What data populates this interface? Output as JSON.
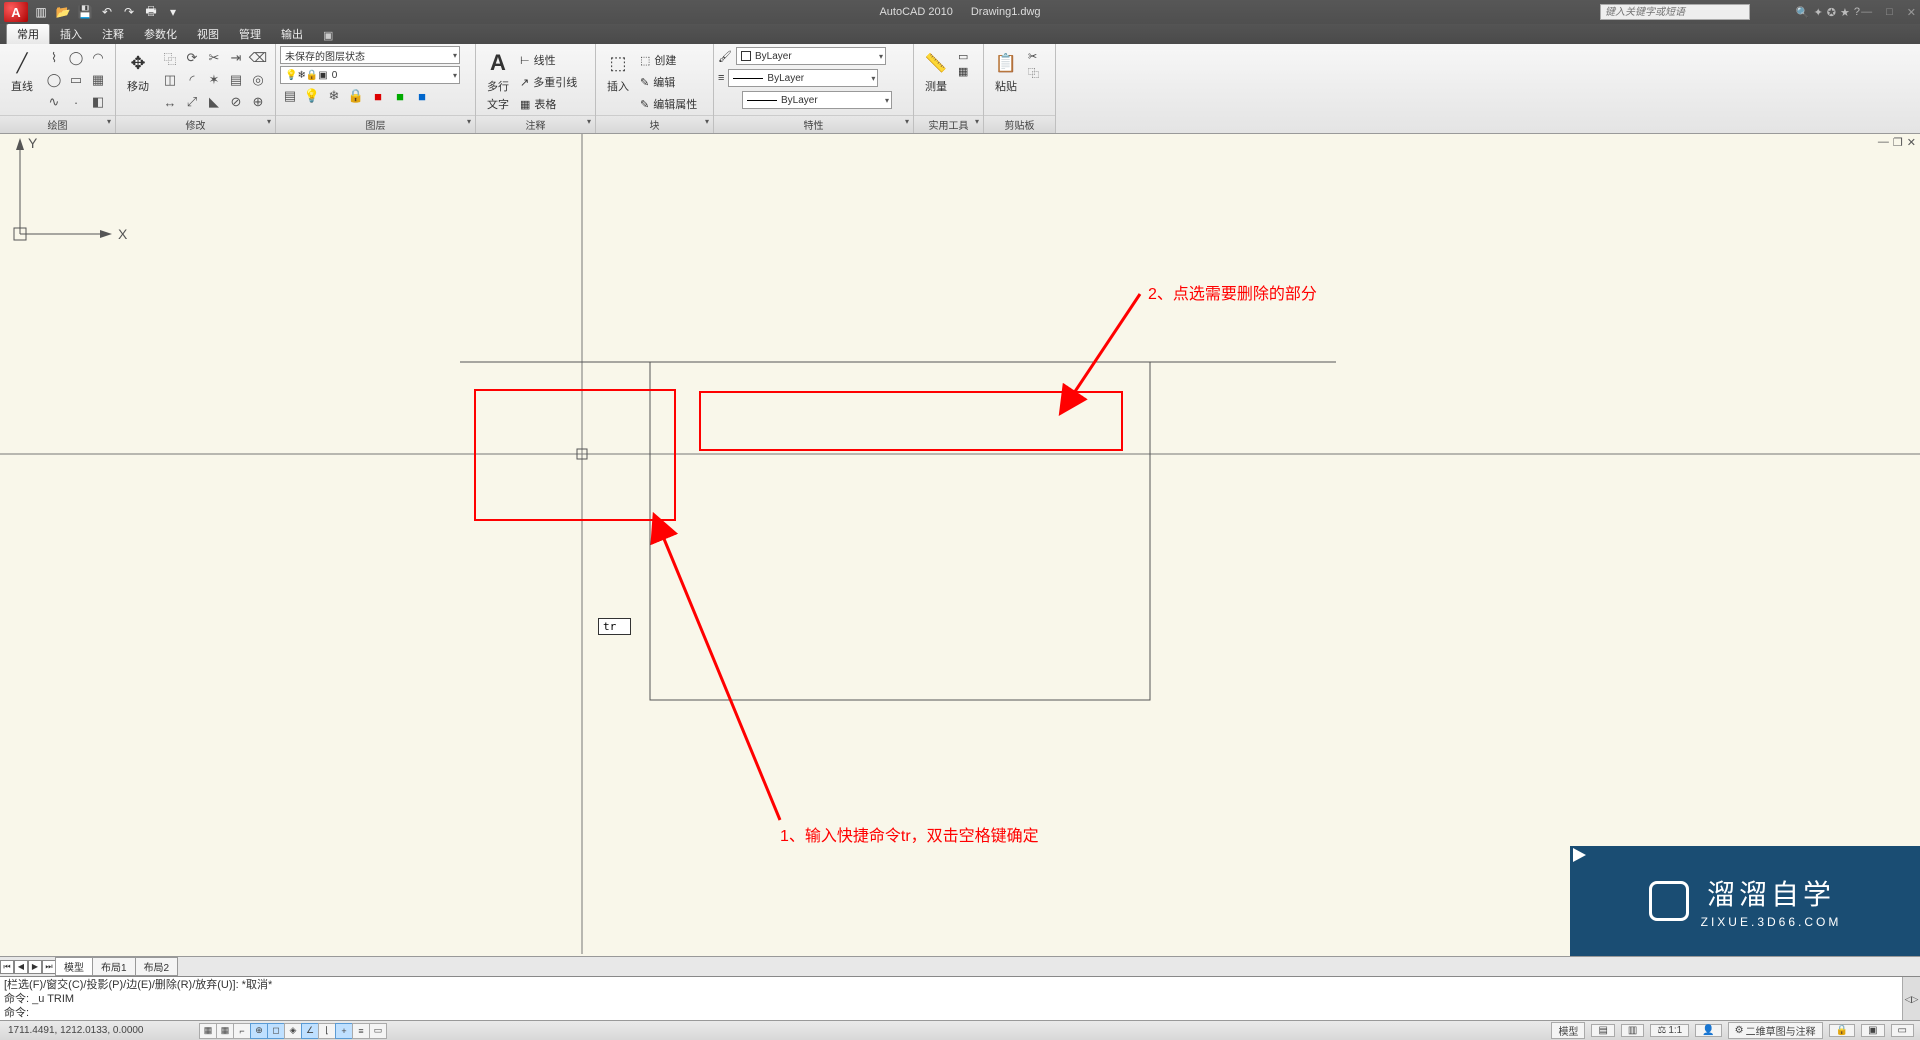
{
  "title": {
    "app": "AutoCAD 2010",
    "file": "Drawing1.dwg"
  },
  "search_placeholder": "键入关键字或短语",
  "tabs": {
    "t0": "常用",
    "t1": "插入",
    "t2": "注释",
    "t3": "参数化",
    "t4": "视图",
    "t5": "管理",
    "t6": "输出"
  },
  "ribbon": {
    "draw": {
      "label": "绘图",
      "line": "直线"
    },
    "modify": {
      "label": "修改",
      "move": "移动"
    },
    "layers": {
      "label": "图层",
      "state": "未保存的图层状态",
      "current": "0"
    },
    "annot": {
      "label": "注释",
      "mtext1": "多行",
      "mtext2": "文字",
      "r0": "线性",
      "r1": "多重引线",
      "r2": "表格"
    },
    "block": {
      "label": "块",
      "insert": "插入",
      "r0": "创建",
      "r1": "编辑",
      "r2": "编辑属性"
    },
    "props": {
      "label": "特性",
      "bylayer": "ByLayer"
    },
    "utils": {
      "label": "实用工具",
      "measure": "测量"
    },
    "clip": {
      "label": "剪贴板",
      "paste": "粘贴"
    }
  },
  "cursor_input": "tr",
  "annotations": {
    "a1": "2、点选需要删除的部分",
    "a2": "1、输入快捷命令tr，双击空格键确定"
  },
  "ucs": {
    "x": "X",
    "y": "Y"
  },
  "watermark": {
    "cn": "溜溜自学",
    "en": "ZIXUE.3D66.COM"
  },
  "layout_tabs": {
    "t0": "模型",
    "t1": "布局1",
    "t2": "布局2"
  },
  "cmd": {
    "l0": "[栏选(F)/窗交(C)/投影(P)/边(E)/删除(R)/放弃(U)]:  *取消*",
    "l1": "命令: _u TRIM",
    "prompt": "命令:"
  },
  "status": {
    "coords": "1711.4491, 1212.0133, 0.0000",
    "right": {
      "model": "模型",
      "scale": "1:1",
      "ws": "二维草图与注释"
    }
  }
}
